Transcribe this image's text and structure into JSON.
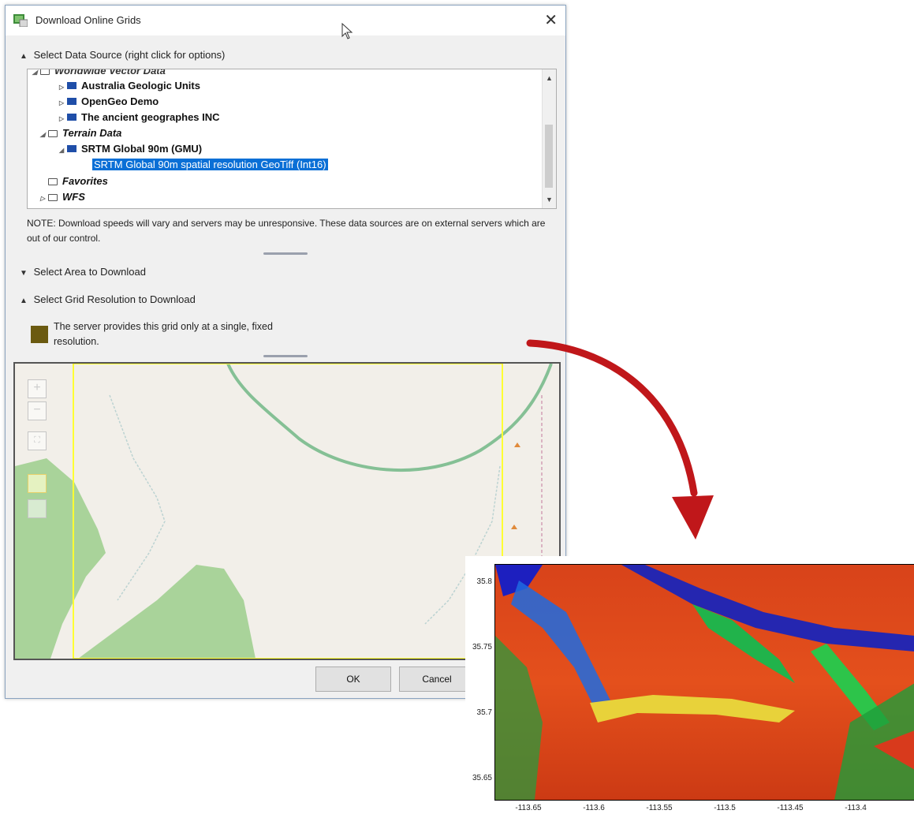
{
  "dialog": {
    "title": "Download Online Grids",
    "close_label": "✕"
  },
  "sections": {
    "data_source": "Select Data Source (right click for options)",
    "area": "Select Area to Download",
    "resolution": "Select Grid Resolution to Download"
  },
  "tree": {
    "clipped_label": "Worldwide Vector Data",
    "items": [
      {
        "label": "Australia Geologic Units"
      },
      {
        "label": "OpenGeo Demo"
      },
      {
        "label": "The ancient geographes INC"
      },
      {
        "label": "Terrain Data"
      },
      {
        "label": "SRTM Global 90m (GMU)"
      },
      {
        "label": "SRTM Global 90m spatial resolution GeoTiff (Int16)"
      },
      {
        "label": "Favorites"
      },
      {
        "label": "WFS"
      }
    ]
  },
  "note": "NOTE: Download speeds will vary and servers may be unresponsive.  These data sources are on external servers which are out of our control.",
  "resolution_text": "The server provides this grid only at a single, fixed resolution.",
  "buttons": {
    "ok": "OK",
    "cancel": "Cancel"
  },
  "map_controls": {
    "zoom_in": "+",
    "zoom_out": "−"
  },
  "colors": {
    "selection": "#0a6fd6",
    "arrow": "#c0171a",
    "selection_box": "#ffff33",
    "road": "#85c095",
    "park": "#a9d39a"
  },
  "chart_data": {
    "type": "heatmap",
    "y_ticks": [
      "35.8",
      "35.75",
      "35.7",
      "35.65"
    ],
    "x_ticks": [
      "-113.65",
      "-113.6",
      "-113.55",
      "-113.5",
      "-113.45",
      "-113.4"
    ],
    "colormap": [
      "blue",
      "green",
      "yellow",
      "orange",
      "red"
    ]
  }
}
